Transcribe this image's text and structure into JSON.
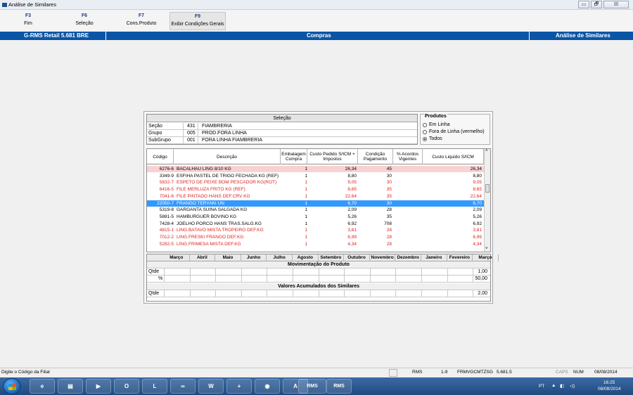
{
  "window": {
    "title": "Análise de Similares",
    "minimize": "▭",
    "maximize": "🗗",
    "close": "☒"
  },
  "toolbar": [
    {
      "key": "F3",
      "label": "Fim"
    },
    {
      "key": "F6",
      "label": "Seleção"
    },
    {
      "key": "F7",
      "label": "Cons.Produto"
    },
    {
      "key": "F9",
      "label": "Exibir Condições Gerais"
    }
  ],
  "header": {
    "left": "G-RMS Retail 5.681 BRE",
    "center": "Compras",
    "right": "Análise de Similares"
  },
  "selecao": {
    "title": "Seleção",
    "rows": [
      {
        "label": "Seção",
        "code": "431",
        "name": "FIAMBRERIA"
      },
      {
        "label": "Grupo",
        "code": "005",
        "name": "PROD.FORA LINHA"
      },
      {
        "label": "SubGrupo",
        "code": "001",
        "name": "FORA LINHA FIAMBRERIA"
      }
    ]
  },
  "produtos": {
    "title": "Produtos",
    "options": [
      {
        "label": "Em Linha",
        "selected": false
      },
      {
        "label": "Fora de Linha (vermelho)",
        "selected": false
      },
      {
        "label": "Todos",
        "selected": true
      }
    ]
  },
  "grid": {
    "headers": [
      "Código",
      "Descrição",
      "Embalagem Compra",
      "Custo Pedido S/ICM + Impostos",
      "Condição Pagamento",
      "% Acordos Vigentes",
      "Custo Liquido S/ICM"
    ],
    "rows": [
      {
        "code": "6276-6",
        "desc": "BACALHAU LING 8/10 KG",
        "emb": "1",
        "custo": "26,34",
        "cond": "45",
        "acordos": "",
        "liquido": "26,34",
        "style": "pink"
      },
      {
        "code": "3349-9",
        "desc": "ESFIHA PASTEL DE TRIGO FECHADA KG (REF)",
        "emb": "1",
        "custo": "8,80",
        "cond": "30",
        "acordos": "",
        "liquido": "8,80",
        "style": "normal"
      },
      {
        "code": "5832-7",
        "desc": "ESPETO DE PEIXE BOM PESCADOR KG(ROT)",
        "emb": "1",
        "custo": "9,05",
        "cond": "30",
        "acordos": "",
        "liquido": "9,05",
        "style": "red"
      },
      {
        "code": "6416-5",
        "desc": "FILE MERLUZA FRITO KG (REF)",
        "emb": "1",
        "custo": "8,65",
        "cond": "35",
        "acordos": "",
        "liquido": "8,65",
        "style": "red"
      },
      {
        "code": "7041-6",
        "desc": "FILE PINTADO HANS DEF.CRV KG",
        "emb": "1",
        "custo": "22,64",
        "cond": "35",
        "acordos": "",
        "liquido": "22,64",
        "style": "red"
      },
      {
        "code": "22050-7",
        "desc": "FRANGO TERYAKI UN",
        "emb": "1",
        "custo": "6,70",
        "cond": "30",
        "acordos": "",
        "liquido": "6,70",
        "style": "selected"
      },
      {
        "code": "5319-8",
        "desc": "GARGANTA SUINA SALGADA KG",
        "emb": "1",
        "custo": "2,09",
        "cond": "28",
        "acordos": "",
        "liquido": "2,09",
        "style": "normal"
      },
      {
        "code": "5881-5",
        "desc": "HAMBURGUER BOVINO KG",
        "emb": "1",
        "custo": "5,26",
        "cond": "35",
        "acordos": "",
        "liquido": "5,26",
        "style": "normal"
      },
      {
        "code": "7428-4",
        "desc": "JOELHO PORCO HANS TRAS.SALG.KG",
        "emb": "1",
        "custo": "6,92",
        "cond": "708",
        "acordos": "",
        "liquido": "6,92",
        "style": "normal"
      },
      {
        "code": "4815-1",
        "desc": "LING.BATAVO MISTA TROPEIRO DEF.KG",
        "emb": "1",
        "custo": "3,81",
        "cond": "28",
        "acordos": "",
        "liquido": "3,81",
        "style": "red"
      },
      {
        "code": "7012-2",
        "desc": "LING.FRESKI FRANGO DEF.KG",
        "emb": "1",
        "custo": "6,99",
        "cond": "28",
        "acordos": "",
        "liquido": "6,99",
        "style": "red"
      },
      {
        "code": "5282-5",
        "desc": "LING.FRIMESA MISTA DEF.KG",
        "emb": "1",
        "custo": "4,34",
        "cond": "28",
        "acordos": "",
        "liquido": "4,34",
        "style": "red"
      }
    ]
  },
  "months": {
    "headers": [
      "Março",
      "Abril",
      "Maio",
      "Junho",
      "Julho",
      "Agosto",
      "Setembro",
      "Outubro",
      "Novembro",
      "Dezembro",
      "Janeiro",
      "Fevereiro",
      "Março"
    ],
    "section1": "Movimentação do Produto",
    "qtde_label": "Qtde",
    "pct_label": "%",
    "qtde_value": "1,00",
    "pct_value": "50,00",
    "section2": "Valores Acumulados dos Similares",
    "acum_label": "Qtde",
    "acum_value": "2,00"
  },
  "statusbar": {
    "hint": "Digite o Código da Filial",
    "rms": "RMS",
    "page": "1-9",
    "user": "FRMVGCMTZSG",
    "version": "5.681.5",
    "caps": "CAPS",
    "num": "NUM",
    "date": "08/08/2014"
  },
  "taskbar": {
    "apps": [
      "ie",
      "explorer",
      "media",
      "outlook",
      "lync",
      "chat",
      "word",
      "calc",
      "drive",
      "pdf",
      "RMS",
      "RMS"
    ],
    "tray_lang": "PT",
    "time": "16:25",
    "date": "08/08/2014"
  }
}
